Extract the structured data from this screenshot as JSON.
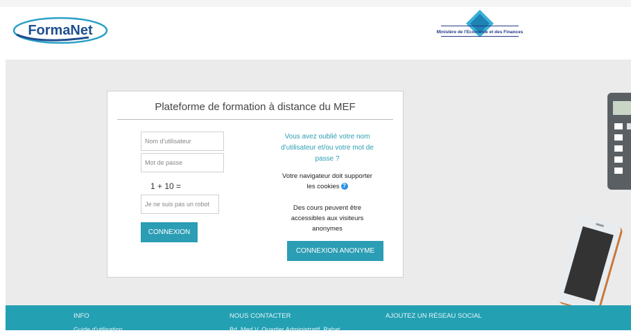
{
  "header": {
    "logo_text": "FormaNet",
    "ministry_name": "Ministère de l'Economie et des Finances"
  },
  "login": {
    "title": "Plateforme de formation à distance du MEF",
    "username_placeholder": "Nom d'utilisateur",
    "password_placeholder": "Mot de passe",
    "captcha_question": "1 + 10 =",
    "captcha_placeholder": "Je ne suis pas un robot",
    "login_button": "CONNEXION",
    "forgot_link": "Vous avez oublié votre nom d'utilisateur et/ou votre mot de passe ?",
    "cookies_notice": "Votre navigateur doit supporter les cookies",
    "guest_notice": "Des cours peuvent être accessibles aux visiteurs anonymes",
    "guest_button": "CONNEXION ANONYME"
  },
  "footer": {
    "info_heading": "INFO",
    "info_item": "Guide d'utilisation",
    "contact_heading": "NOUS CONTACTER",
    "contact_address": "Bd. Med V, Quartier Administratif, Rabat",
    "social_heading": "AJOUTEZ UN RÉSEAU SOCIAL"
  },
  "colors": {
    "accent": "#2b9db4",
    "footer_bg": "#24a0b3",
    "logo_blue": "#1d4f8f"
  }
}
